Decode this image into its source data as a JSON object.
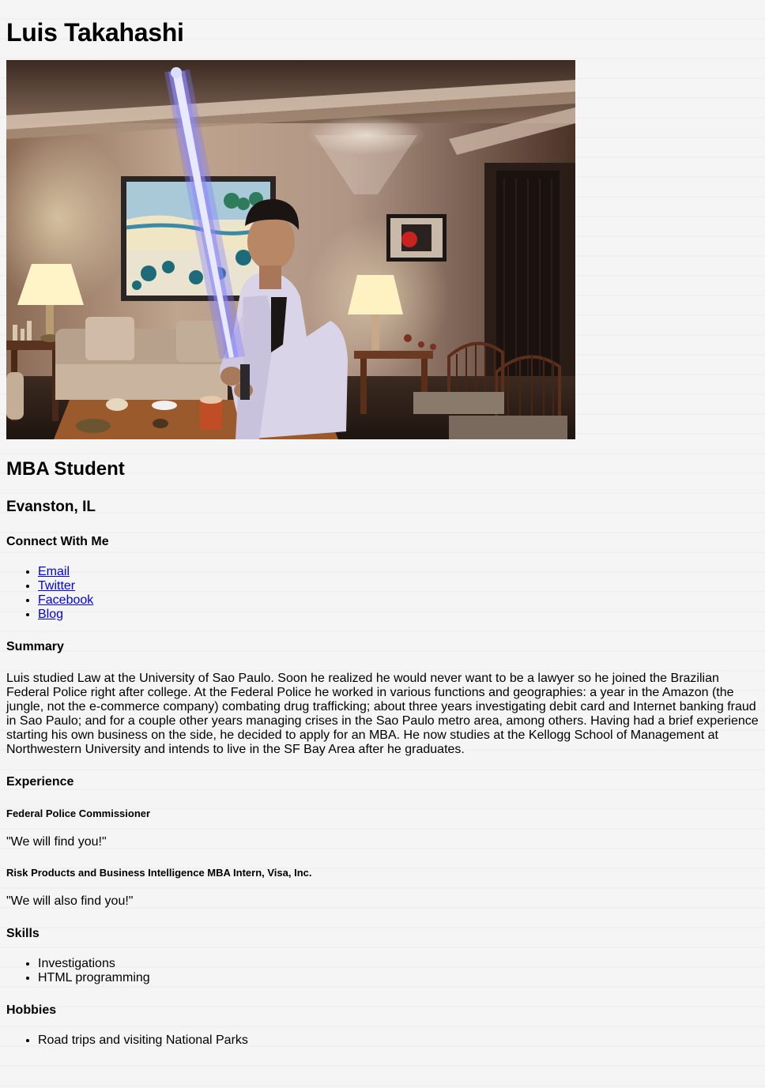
{
  "profile": {
    "name": "Luis Takahashi",
    "title": "MBA Student",
    "location": "Evanston, IL"
  },
  "connect": {
    "heading": "Connect With Me",
    "links": [
      {
        "label": "Email"
      },
      {
        "label": "Twitter"
      },
      {
        "label": "Facebook"
      },
      {
        "label": "Blog"
      }
    ]
  },
  "summary": {
    "heading": "Summary",
    "text": "Luis studied Law at the University of Sao Paulo. Soon he realized he would never want to be a lawyer so he joined the Brazilian Federal Police right after college. At the Federal Police he worked in various functions and geographies: a year in the Amazon (the jungle, not the e-commerce company) combating drug trafficking; about three years investigating debit card and Internet banking fraud in Sao Paulo; and for a couple other years managing crises in the Sao Paulo metro area, among others. Having had a brief experience starting his own business on the side, he decided to apply for an MBA. He now studies at the Kellogg School of Management at Northwestern University and intends to live in the SF Bay Area after he graduates."
  },
  "experience": {
    "heading": "Experience",
    "jobs": [
      {
        "title": "Federal Police Commissioner",
        "quote": "\"We will find you!\""
      },
      {
        "title": "Risk Products and Business Intelligence MBA Intern, Visa, Inc.",
        "quote": "\"We will also find you!\""
      }
    ]
  },
  "skills": {
    "heading": "Skills",
    "items": [
      "Investigations",
      "HTML programming"
    ]
  },
  "hobbies": {
    "heading": "Hobbies",
    "items": [
      "Road trips and visiting National Parks"
    ]
  },
  "colors": {
    "link": "#0000ee",
    "lightsaber": "#6f6bff"
  }
}
